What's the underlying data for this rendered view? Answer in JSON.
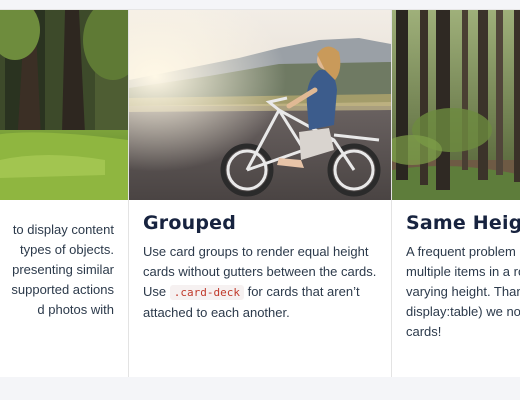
{
  "cards": [
    {
      "title": "",
      "text_lines": [
        "to display content",
        "types of objects.",
        "presenting similar",
        "supported actions",
        "d photos with"
      ]
    },
    {
      "title": "Grouped",
      "text_before_code": "Use card groups to render equal height cards without gutters between the cards. Use ",
      "code": ".card-deck",
      "text_after_code": " for cards that aren’t attached to each another."
    },
    {
      "title": "Same Height",
      "text": "A frequent problem o multiple items in a row varying height. Thank display:table) we now cards!"
    }
  ],
  "colors": {
    "title": "#17233f",
    "text": "#2c3a4b",
    "code": "#c0392b",
    "page_background": "#f4f5f8"
  }
}
